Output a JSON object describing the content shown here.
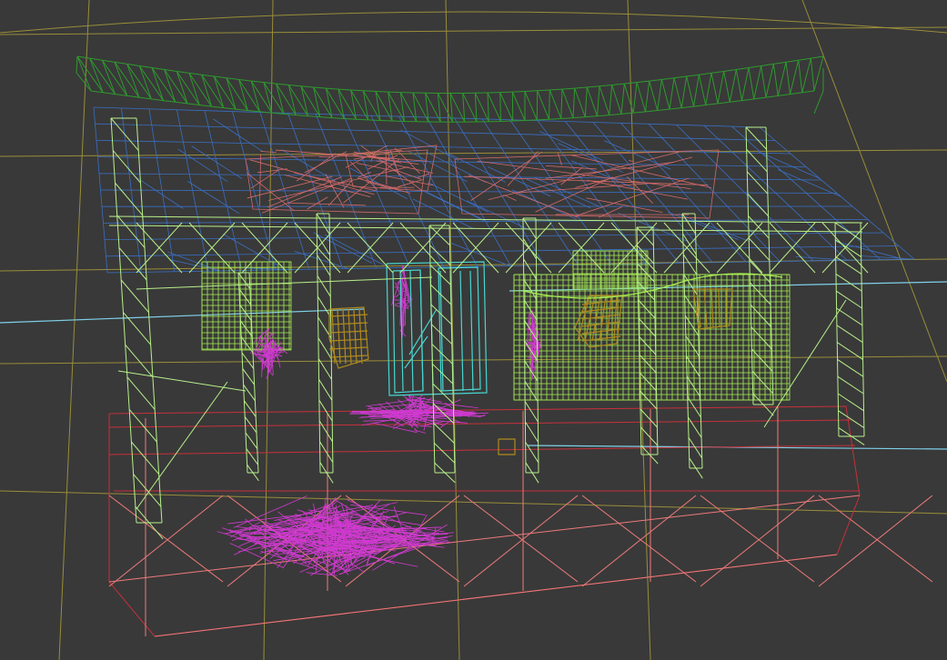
{
  "viewport": {
    "background": "#393939",
    "mode": "wireframe",
    "subject": "3d-house-model"
  },
  "layers": [
    {
      "name": "roof-ridge",
      "color": "#2e9a2e"
    },
    {
      "name": "roof",
      "color": "#3a6fc4"
    },
    {
      "name": "roof-patches",
      "color": "#d46a6a"
    },
    {
      "name": "posts",
      "color": "#b8f08a"
    },
    {
      "name": "panels",
      "color": "#a8ef52"
    },
    {
      "name": "door",
      "color": "#48d6cf"
    },
    {
      "name": "fabric",
      "color": "#d03ad0"
    },
    {
      "name": "baskets",
      "color": "#b08a1e"
    },
    {
      "name": "base-platform",
      "color": "#c8303a"
    },
    {
      "name": "base-lines",
      "color": "#f07a7a"
    },
    {
      "name": "grid",
      "color": "#b9a93a"
    },
    {
      "name": "guide-line",
      "color": "#7fd0e8"
    }
  ]
}
